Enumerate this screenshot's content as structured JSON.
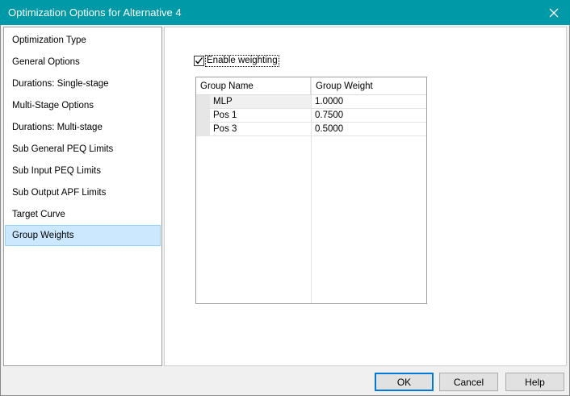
{
  "window": {
    "title": "Optimization Options for Alternative 4"
  },
  "sidebar": {
    "items": [
      {
        "label": "Optimization Type",
        "selected": false
      },
      {
        "label": "General Options",
        "selected": false
      },
      {
        "label": "Durations: Single-stage",
        "selected": false
      },
      {
        "label": "Multi-Stage Options",
        "selected": false
      },
      {
        "label": "Durations: Multi-stage",
        "selected": false
      },
      {
        "label": "Sub General PEQ Limits",
        "selected": false
      },
      {
        "label": "Sub Input PEQ Limits",
        "selected": false
      },
      {
        "label": "Sub Output APF Limits",
        "selected": false
      },
      {
        "label": "Target Curve",
        "selected": false
      },
      {
        "label": "Group Weights",
        "selected": true
      }
    ]
  },
  "weighting": {
    "label": "Enable weighting",
    "checked": true
  },
  "grid": {
    "columns": [
      "Group Name",
      "Group Weight"
    ],
    "rows": [
      {
        "name": "MLP",
        "weight": "1.0000"
      },
      {
        "name": "Pos 1",
        "weight": "0.7500"
      },
      {
        "name": "Pos 3",
        "weight": "0.5000"
      }
    ]
  },
  "buttons": {
    "ok": "OK",
    "cancel": "Cancel",
    "help": "Help"
  },
  "colors": {
    "titlebar": "#0099a8",
    "selection": "#cce8ff",
    "selection_border": "#99d1ff",
    "default_button_border": "#0078d7"
  },
  "icons": {
    "close": "close-icon",
    "checkbox_mark": "checkmark-icon"
  }
}
